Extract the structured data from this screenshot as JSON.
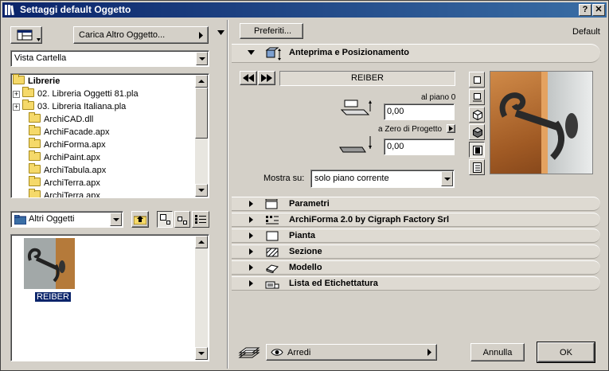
{
  "window": {
    "title": "Settaggi default Oggetto",
    "help_label": "?",
    "close_label": "✕"
  },
  "left": {
    "load_other_label": "Carica Altro Oggetto...",
    "view_mode_value": "Vista Cartella",
    "tree": [
      {
        "label": "Librerie",
        "bold": true
      },
      {
        "label": "02. Libreria Oggetti 81.pla",
        "expandable": true
      },
      {
        "label": "03. Libreria Italiana.pla",
        "expandable": true
      },
      {
        "label": "ArchiCAD.dll"
      },
      {
        "label": "ArchiFacade.apx"
      },
      {
        "label": "ArchiForma.apx"
      },
      {
        "label": "ArchiPaint.apx"
      },
      {
        "label": "ArchiTabula.apx"
      },
      {
        "label": "ArchiTerra.apx"
      },
      {
        "label": "ArchiTerra.apx"
      }
    ],
    "category_value": "Altri Oggetti",
    "object_label": "REIBER"
  },
  "right": {
    "favorites_label": "Preferiti...",
    "default_label": "Default",
    "preview_section_title": "Anteprima e Posizionamento",
    "object_name": "REIBER",
    "al_piano_label": "al piano 0",
    "offset_value": "0,00",
    "zero_progetto_label": "a Zero di Progetto",
    "zero_value": "0,00",
    "mostra_label": "Mostra su:",
    "mostra_value": "solo piano corrente",
    "sections": [
      {
        "title": "Parametri"
      },
      {
        "title": "ArchiForma 2.0 by Cigraph Factory Srl"
      },
      {
        "title": "Pianta"
      },
      {
        "title": "Sezione"
      },
      {
        "title": "Modello"
      },
      {
        "title": "Lista ed Etichettatura"
      }
    ],
    "layer_value": "Arredi",
    "cancel_label": "Annulla",
    "ok_label": "OK"
  }
}
